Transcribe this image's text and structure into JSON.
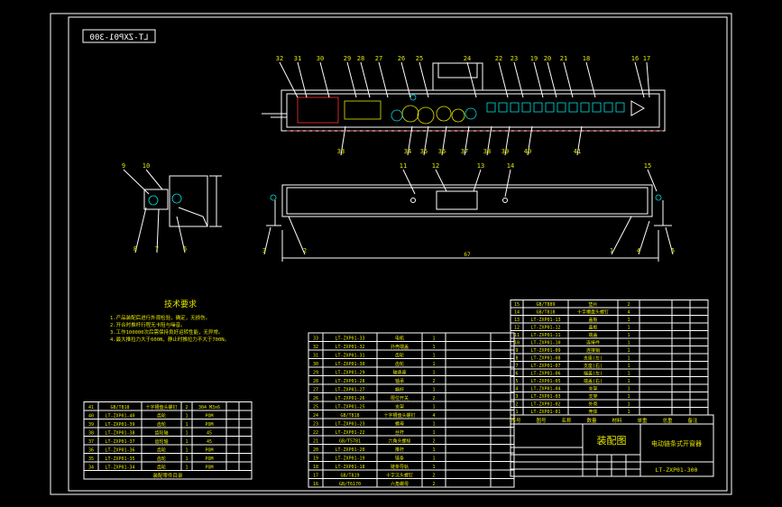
{
  "drawing_number_mirrored": "LT-ZXP01-300",
  "callouts_top": [
    "32",
    "31",
    "30",
    "29",
    "28",
    "27",
    "26",
    "25",
    "24",
    "22",
    "23",
    "19",
    "20",
    "21",
    "18",
    "16",
    "17"
  ],
  "callouts_under": [
    "33",
    "34",
    "35",
    "36",
    "37",
    "38",
    "39",
    "40",
    "41"
  ],
  "callouts_side": [
    "9",
    "10",
    "8",
    "7",
    "6"
  ],
  "callouts_front": [
    "11",
    "12",
    "13",
    "14",
    "15",
    "2",
    "3",
    "1",
    "4",
    "5"
  ],
  "overall_dim": "67",
  "tech_req": {
    "title": "技术要求",
    "lines": [
      "1.产品装配后进行外观检验，确定，无损伤。",
      "2.开合时推杆行程无卡阻与噪音。",
      "3.工作100000次后需保持良好运转性能，无异常。",
      "4.最大推拉力大于600N，静止时推拉力不大于700N。"
    ]
  },
  "bom_left": [
    {
      "no": "41",
      "code": "GB/T818",
      "name": "十字槽盘头螺钉",
      "qty": "2",
      "mat": "304 M3x6",
      "w1": "",
      "w2": ""
    },
    {
      "no": "40",
      "code": "LT-ZXP01-40",
      "name": "齿轮",
      "qty": "1",
      "mat": "POM",
      "w1": "",
      "w2": ""
    },
    {
      "no": "39",
      "code": "LT-ZXP01-39",
      "name": "齿轮",
      "qty": "1",
      "mat": "POM",
      "w1": "",
      "w2": ""
    },
    {
      "no": "38",
      "code": "LT-ZXP01-38",
      "name": "齿轮轴",
      "qty": "1",
      "mat": "45",
      "w1": "",
      "w2": ""
    },
    {
      "no": "37",
      "code": "LT-ZXP01-37",
      "name": "齿轮轴",
      "qty": "1",
      "mat": "45",
      "w1": "",
      "w2": ""
    },
    {
      "no": "36",
      "code": "LT-ZXP01-36",
      "name": "齿轮",
      "qty": "1",
      "mat": "POM",
      "w1": "",
      "w2": ""
    },
    {
      "no": "35",
      "code": "LT-ZXP01-35",
      "name": "齿轮",
      "qty": "1",
      "mat": "POM",
      "w1": "",
      "w2": ""
    },
    {
      "no": "34",
      "code": "LT-ZXP01-34",
      "name": "齿轮",
      "qty": "1",
      "mat": "POM",
      "w1": "",
      "w2": ""
    }
  ],
  "bom_left_footer": "装配零件目录",
  "bom_mid": [
    {
      "no": "33",
      "code": "LT-ZXP01-33",
      "name": "电机",
      "qty": "1"
    },
    {
      "no": "32",
      "code": "LT-ZXP01-32",
      "name": "外壳端盖",
      "qty": "1"
    },
    {
      "no": "31",
      "code": "LT-ZXP01-31",
      "name": "齿轮",
      "qty": "1"
    },
    {
      "no": "30",
      "code": "LT-ZXP01-30",
      "name": "齿轮",
      "qty": "1"
    },
    {
      "no": "29",
      "code": "LT-ZXP01-29",
      "name": "轴承座",
      "qty": "1"
    },
    {
      "no": "28",
      "code": "LT-ZXP01-28",
      "name": "轴承",
      "qty": "2"
    },
    {
      "no": "27",
      "code": "LT-ZXP01-27",
      "name": "蜗杆",
      "qty": "1"
    },
    {
      "no": "26",
      "code": "LT-ZXP01-26",
      "name": "限位开关",
      "qty": "2"
    },
    {
      "no": "25",
      "code": "LT-ZXP01-25",
      "name": "支架",
      "qty": "1"
    },
    {
      "no": "24",
      "code": "GB/T818",
      "name": "十字槽盘头螺钉",
      "qty": "4"
    },
    {
      "no": "23",
      "code": "LT-ZXP01-23",
      "name": "螺母",
      "qty": "1"
    },
    {
      "no": "22",
      "code": "LT-ZXP01-22",
      "name": "丝杆",
      "qty": "1"
    },
    {
      "no": "21",
      "code": "GB/T5781",
      "name": "六角头螺栓",
      "qty": "2"
    },
    {
      "no": "20",
      "code": "LT-ZXP01-20",
      "name": "推杆",
      "qty": "1"
    },
    {
      "no": "19",
      "code": "LT-ZXP01-19",
      "name": "链条",
      "qty": "1"
    },
    {
      "no": "18",
      "code": "LT-ZXP01-18",
      "name": "链条导轨",
      "qty": "1"
    },
    {
      "no": "17",
      "code": "GB/T819",
      "name": "十字沉头螺钉",
      "qty": "2"
    },
    {
      "no": "16",
      "code": "GB/T6170",
      "name": "六角螺母",
      "qty": "2"
    }
  ],
  "bom_right": [
    {
      "no": "15",
      "code": "GB/T889",
      "name": "垫片",
      "qty": "2"
    },
    {
      "no": "14",
      "code": "GB/T818",
      "name": "十字槽盘头螺钉",
      "qty": "4"
    },
    {
      "no": "13",
      "code": "LT-ZXP01-13",
      "name": "盖板",
      "qty": "1"
    },
    {
      "no": "12",
      "code": "LT-ZXP01-12",
      "name": "盖板",
      "qty": "1"
    },
    {
      "no": "11",
      "code": "LT-ZXP01-11",
      "name": "端盖",
      "qty": "1"
    },
    {
      "no": "10",
      "code": "LT-ZXP01-10",
      "name": "连接件",
      "qty": "1"
    },
    {
      "no": "9",
      "code": "LT-ZXP01-09",
      "name": "连接销",
      "qty": "1"
    },
    {
      "no": "8",
      "code": "LT-ZXP01-08",
      "name": "支座(左)",
      "qty": "1"
    },
    {
      "no": "7",
      "code": "LT-ZXP01-07",
      "name": "支座(右)",
      "qty": "1"
    },
    {
      "no": "6",
      "code": "LT-ZXP01-06",
      "name": "端盖(左)",
      "qty": "1"
    },
    {
      "no": "5",
      "code": "LT-ZXP01-05",
      "name": "端盖(右)",
      "qty": "1"
    },
    {
      "no": "4",
      "code": "LT-ZXP01-04",
      "name": "支架",
      "qty": "1"
    },
    {
      "no": "3",
      "code": "LT-ZXP01-03",
      "name": "支架",
      "qty": "1"
    },
    {
      "no": "2",
      "code": "LT-ZXP01-02",
      "name": "外壳",
      "qty": "1"
    },
    {
      "no": "1",
      "code": "LT-ZXP01-01",
      "name": "壳体",
      "qty": "1"
    }
  ],
  "bom_header": [
    "序号",
    "图号",
    "名称",
    "数量",
    "材料",
    "单重",
    "总重",
    "备注"
  ],
  "title_block": {
    "drawing_type": "装配图",
    "product_name": "电动链条式开窗器",
    "drawing_number": "LT-ZXP01-300"
  }
}
